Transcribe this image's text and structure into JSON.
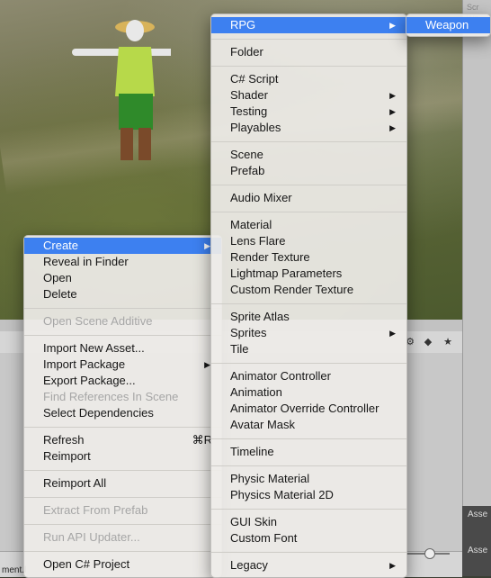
{
  "scene": {
    "inspector_partial": "Scr",
    "inspector_partial2": "We",
    "inspector_dark_label": "Asse",
    "inspector_dark_label2": "Asse"
  },
  "bottom_bar": {
    "file_fragment": "ment.l"
  },
  "left_menu": [
    {
      "label": "Create",
      "has_submenu": true,
      "highlighted": true,
      "enabled": true
    },
    {
      "label": "Reveal in Finder",
      "enabled": true
    },
    {
      "label": "Open",
      "enabled": true
    },
    {
      "label": "Delete",
      "enabled": true
    },
    {
      "separator": true
    },
    {
      "label": "Open Scene Additive",
      "enabled": false
    },
    {
      "separator": true
    },
    {
      "label": "Import New Asset...",
      "enabled": true
    },
    {
      "label": "Import Package",
      "has_submenu": true,
      "enabled": true
    },
    {
      "label": "Export Package...",
      "enabled": true
    },
    {
      "label": "Find References In Scene",
      "enabled": false
    },
    {
      "label": "Select Dependencies",
      "enabled": true
    },
    {
      "separator": true
    },
    {
      "label": "Refresh",
      "shortcut": "⌘R",
      "enabled": true
    },
    {
      "label": "Reimport",
      "enabled": true
    },
    {
      "separator": true
    },
    {
      "label": "Reimport All",
      "enabled": true
    },
    {
      "separator": true
    },
    {
      "label": "Extract From Prefab",
      "enabled": false
    },
    {
      "separator": true
    },
    {
      "label": "Run API Updater...",
      "enabled": false
    },
    {
      "separator": true
    },
    {
      "label": "Open C# Project",
      "enabled": true
    }
  ],
  "create_menu": [
    {
      "label": "RPG",
      "has_submenu": true,
      "highlighted": true,
      "enabled": true
    },
    {
      "separator": true
    },
    {
      "label": "Folder",
      "enabled": true
    },
    {
      "separator": true
    },
    {
      "label": "C# Script",
      "enabled": true
    },
    {
      "label": "Shader",
      "has_submenu": true,
      "enabled": true
    },
    {
      "label": "Testing",
      "has_submenu": true,
      "enabled": true
    },
    {
      "label": "Playables",
      "has_submenu": true,
      "enabled": true
    },
    {
      "separator": true
    },
    {
      "label": "Scene",
      "enabled": true
    },
    {
      "label": "Prefab",
      "enabled": true
    },
    {
      "separator": true
    },
    {
      "label": "Audio Mixer",
      "enabled": true
    },
    {
      "separator": true
    },
    {
      "label": "Material",
      "enabled": true
    },
    {
      "label": "Lens Flare",
      "enabled": true
    },
    {
      "label": "Render Texture",
      "enabled": true
    },
    {
      "label": "Lightmap Parameters",
      "enabled": true
    },
    {
      "label": "Custom Render Texture",
      "enabled": true
    },
    {
      "separator": true
    },
    {
      "label": "Sprite Atlas",
      "enabled": true
    },
    {
      "label": "Sprites",
      "has_submenu": true,
      "enabled": true
    },
    {
      "label": "Tile",
      "enabled": true
    },
    {
      "separator": true
    },
    {
      "label": "Animator Controller",
      "enabled": true
    },
    {
      "label": "Animation",
      "enabled": true
    },
    {
      "label": "Animator Override Controller",
      "enabled": true
    },
    {
      "label": "Avatar Mask",
      "enabled": true
    },
    {
      "separator": true
    },
    {
      "label": "Timeline",
      "enabled": true
    },
    {
      "separator": true
    },
    {
      "label": "Physic Material",
      "enabled": true
    },
    {
      "label": "Physics Material 2D",
      "enabled": true
    },
    {
      "separator": true
    },
    {
      "label": "GUI Skin",
      "enabled": true
    },
    {
      "label": "Custom Font",
      "enabled": true
    },
    {
      "separator": true
    },
    {
      "label": "Legacy",
      "has_submenu": true,
      "enabled": true
    }
  ],
  "rpg_menu": [
    {
      "label": "Weapon",
      "highlighted": true,
      "enabled": true
    }
  ],
  "colors": {
    "highlight": "#3d80f0",
    "menu_bg": "#eeece8",
    "disabled_text": "#a6a6a6"
  }
}
